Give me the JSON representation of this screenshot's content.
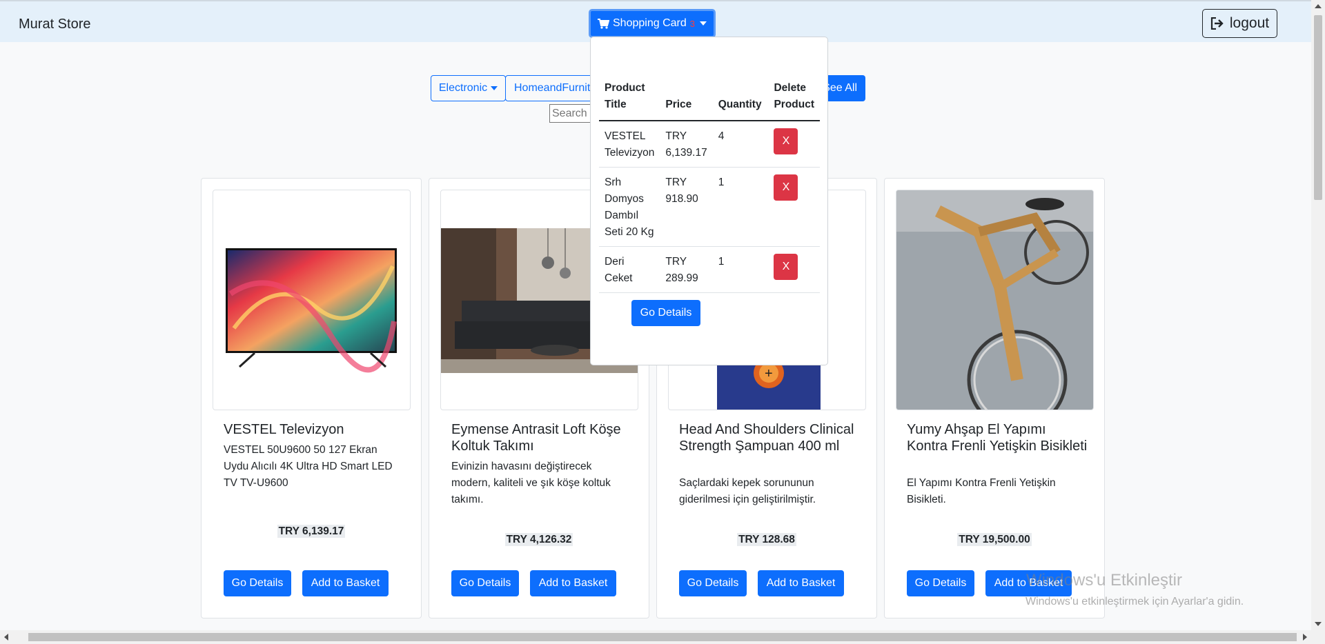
{
  "navbar": {
    "brand": "Murat Store",
    "cart_label": "Shopping Card",
    "cart_count": "3",
    "logout_label": "logout"
  },
  "filters": {
    "electronic": "Electronic",
    "home": "HomeandFurnit",
    "see_all": "See All",
    "search_placeholder": "Search"
  },
  "cart": {
    "headers": {
      "title": "Product Title",
      "price": "Price",
      "quantity": "Quantity",
      "delete": "Delete Product"
    },
    "items": [
      {
        "title": "VESTEL Televizyon",
        "price": "TRY 6,139.17",
        "quantity": "4",
        "delete": "X"
      },
      {
        "title": "Srh Domyos Dambıl Seti 20 Kg",
        "price": "TRY 918.90",
        "quantity": "1",
        "delete": "X"
      },
      {
        "title": "Deri Ceket",
        "price": "TRY 289.99",
        "quantity": "1",
        "delete": "X"
      }
    ],
    "go_details": "Go Details"
  },
  "products": [
    {
      "title": "VESTEL Televizyon",
      "description": "VESTEL 50U9600 50 127 Ekran Uydu Alıcılı 4K Ultra HD Smart LED TV TV-U9600",
      "price": "TRY 6,139.17",
      "details_label": "Go Details",
      "basket_label": "Add to Basket"
    },
    {
      "title": "Eymense Antrasit Loft Köşe Koltuk Takımı",
      "description": "Evinizin havasını değiştirecek modern, kaliteli ve şık köşe koltuk takımı.",
      "price": "TRY 4,126.32",
      "details_label": "Go Details",
      "basket_label": "Add to Basket"
    },
    {
      "title": "Head And Shoulders Clinical Strength Şampuan 400 ml",
      "description": "Saçlardaki kepek sorununun giderilmesi için geliştirilmiştir.",
      "price": "TRY 128.68",
      "details_label": "Go Details",
      "basket_label": "Add to Basket"
    },
    {
      "title": "Yumy Ahşap El Yapımı Kontra Frenli Yetişkin Bisikleti",
      "description": "El Yapımı Kontra Frenli Yetişkin Bisikleti.",
      "price": "TRY 19,500.00",
      "details_label": "Go Details",
      "basket_label": "Add to Basket"
    }
  ],
  "watermark": {
    "title": "Windows'u Etkinleştir",
    "subtitle": "Windows'u etkinleştirmek için Ayarlar'a gidin."
  },
  "icons": {
    "cart": "shopping-cart-icon",
    "logout": "sign-out-icon"
  },
  "colors": {
    "primary": "#0d6efd",
    "danger": "#dc3545",
    "navbar_bg": "#e4f0fa"
  }
}
